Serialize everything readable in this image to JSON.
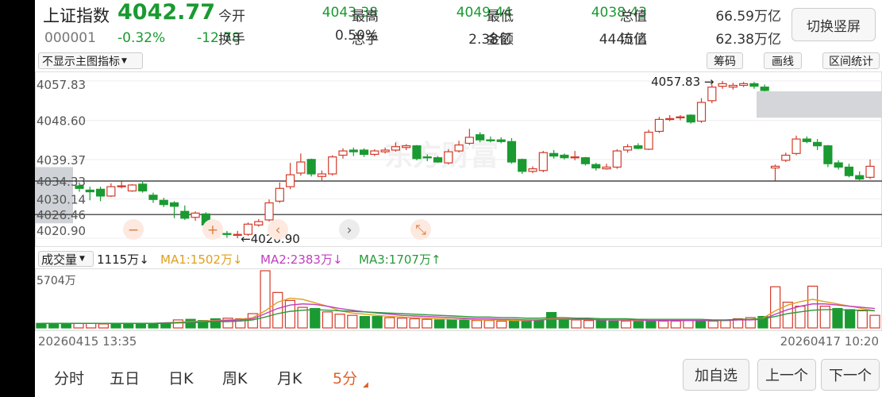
{
  "header": {
    "name": "上证指数",
    "code": "000001",
    "price": "4042.77",
    "pct_change": "-0.32%",
    "change": "-12.78",
    "switch_label": "切换竖屏"
  },
  "quotes": [
    {
      "label": "今开",
      "value": "4043.38",
      "color": "#1a9a31"
    },
    {
      "label": "最高",
      "value": "4049.44",
      "color": "#1a9a31"
    },
    {
      "label": "最低",
      "value": "4038.43",
      "color": "#1a9a31"
    },
    {
      "label": "总值",
      "value": "66.59万亿",
      "color": "#333333"
    },
    {
      "label": "换手",
      "value": "0.50%",
      "color": "#333333"
    },
    {
      "label": "总手",
      "value": "2.38亿",
      "color": "#333333"
    },
    {
      "label": "金额",
      "value": "4445亿",
      "color": "#333333"
    },
    {
      "label": "流值",
      "value": "62.38万亿",
      "color": "#333333"
    }
  ],
  "toolbar": {
    "indicator_dropdown": "不显示主图指标",
    "chips": "筹码",
    "draw": "画线",
    "range_stats": "区间统计"
  },
  "price_axis": {
    "labels": [
      "4057.83",
      "4048.60",
      "4039.37",
      "4034.33",
      "4030.14",
      "4026.46",
      "4020.90"
    ],
    "high_marker": "4057.83",
    "low_marker": "4020.90",
    "hlines": [
      "4034.33",
      "4026.46"
    ]
  },
  "volume": {
    "dropdown": "成交量",
    "current": "1115万",
    "current_arrow": "↓",
    "ma1": "MA1:1502万",
    "ma1_arrow": "↓",
    "ma2": "MA2:2383万",
    "ma2_arrow": "↓",
    "ma3": "MA3:1707万",
    "ma3_arrow": "↑",
    "axis_max": "5704万",
    "colors": {
      "ma1": "#e0a020",
      "ma2": "#c040c0",
      "ma3": "#2a9a3a"
    }
  },
  "time_axis": {
    "start": "20260415 13:35",
    "end": "20260417 10:20"
  },
  "tabs": [
    "分时",
    "五日",
    "日K",
    "周K",
    "月K",
    "5分"
  ],
  "active_tab": 5,
  "buttons": {
    "add_fav": "加自选",
    "prev": "上一个",
    "next": "下一个"
  },
  "colors": {
    "up": "#d43b2a",
    "down": "#1a9a31",
    "price_down": "#1a9a31",
    "active_tab": "#e0612a"
  },
  "chart_data": {
    "type": "candlestick",
    "interval": "5分",
    "ylim": [
      4020.9,
      4057.83
    ],
    "candles": [
      {
        "o": 4033.2,
        "c": 4032.6,
        "h": 4034.0,
        "l": 4031.8
      },
      {
        "o": 4032.2,
        "c": 4031.8,
        "h": 4033.0,
        "l": 4029.8
      },
      {
        "o": 4032.4,
        "c": 4030.8,
        "h": 4033.0,
        "l": 4029.6
      },
      {
        "o": 4030.8,
        "c": 4033.0,
        "h": 4033.8,
        "l": 4030.6
      },
      {
        "o": 4033.0,
        "c": 4033.2,
        "h": 4034.2,
        "l": 4032.6
      },
      {
        "o": 4032.0,
        "c": 4033.4,
        "h": 4033.6,
        "l": 4031.8
      },
      {
        "o": 4033.6,
        "c": 4032.0,
        "h": 4034.4,
        "l": 4031.6
      },
      {
        "o": 4031.0,
        "c": 4030.0,
        "h": 4031.6,
        "l": 4029.2
      },
      {
        "o": 4029.8,
        "c": 4028.8,
        "h": 4030.4,
        "l": 4028.2
      },
      {
        "o": 4029.2,
        "c": 4028.4,
        "h": 4029.6,
        "l": 4025.6
      },
      {
        "o": 4027.2,
        "c": 4025.6,
        "h": 4028.6,
        "l": 4025.2
      },
      {
        "o": 4025.8,
        "c": 4026.8,
        "h": 4027.2,
        "l": 4025.0
      },
      {
        "o": 4026.6,
        "c": 4024.0,
        "h": 4027.0,
        "l": 4023.4
      },
      {
        "o": 4023.0,
        "c": 4022.2,
        "h": 4023.6,
        "l": 4021.6
      },
      {
        "o": 4022.0,
        "c": 4021.8,
        "h": 4022.6,
        "l": 4021.0
      },
      {
        "o": 4021.6,
        "c": 4021.8,
        "h": 4022.6,
        "l": 4020.9
      },
      {
        "o": 4021.8,
        "c": 4024.2,
        "h": 4024.6,
        "l": 4021.4
      },
      {
        "o": 4024.0,
        "c": 4024.8,
        "h": 4025.4,
        "l": 4023.6
      },
      {
        "o": 4025.2,
        "c": 4029.2,
        "h": 4030.0,
        "l": 4024.8
      },
      {
        "o": 4029.6,
        "c": 4032.6,
        "h": 4034.0,
        "l": 4029.2
      },
      {
        "o": 4033.0,
        "c": 4035.8,
        "h": 4038.6,
        "l": 4032.4
      },
      {
        "o": 4036.2,
        "c": 4038.8,
        "h": 4040.8,
        "l": 4035.6
      },
      {
        "o": 4039.4,
        "c": 4036.0,
        "h": 4039.6,
        "l": 4035.4
      },
      {
        "o": 4035.4,
        "c": 4036.0,
        "h": 4036.8,
        "l": 4034.2
      },
      {
        "o": 4036.0,
        "c": 4040.0,
        "h": 4040.4,
        "l": 4035.6
      },
      {
        "o": 4040.4,
        "c": 4041.4,
        "h": 4042.0,
        "l": 4039.6
      },
      {
        "o": 4041.6,
        "c": 4041.2,
        "h": 4042.2,
        "l": 4040.2
      },
      {
        "o": 4041.6,
        "c": 4040.6,
        "h": 4042.0,
        "l": 4040.0
      },
      {
        "o": 4040.6,
        "c": 4041.4,
        "h": 4041.8,
        "l": 4040.2
      },
      {
        "o": 4041.2,
        "c": 4041.6,
        "h": 4042.2,
        "l": 4040.8
      },
      {
        "o": 4041.6,
        "c": 4042.4,
        "h": 4043.4,
        "l": 4041.2
      },
      {
        "o": 4042.2,
        "c": 4042.6,
        "h": 4043.0,
        "l": 4041.6
      },
      {
        "o": 4042.6,
        "c": 4039.6,
        "h": 4042.8,
        "l": 4039.2
      },
      {
        "o": 4040.0,
        "c": 4039.8,
        "h": 4040.6,
        "l": 4039.0
      },
      {
        "o": 4039.8,
        "c": 4038.8,
        "h": 4040.2,
        "l": 4038.6
      },
      {
        "o": 4038.6,
        "c": 4041.2,
        "h": 4041.8,
        "l": 4038.2
      },
      {
        "o": 4041.4,
        "c": 4042.8,
        "h": 4043.8,
        "l": 4041.0
      },
      {
        "o": 4043.2,
        "c": 4044.6,
        "h": 4046.6,
        "l": 4042.8
      },
      {
        "o": 4045.2,
        "c": 4044.0,
        "h": 4045.8,
        "l": 4043.4
      },
      {
        "o": 4044.0,
        "c": 4043.8,
        "h": 4044.8,
        "l": 4043.4
      },
      {
        "o": 4044.0,
        "c": 4043.6,
        "h": 4044.6,
        "l": 4043.2
      },
      {
        "o": 4043.6,
        "c": 4038.8,
        "h": 4044.4,
        "l": 4038.4
      },
      {
        "o": 4039.4,
        "c": 4036.6,
        "h": 4039.6,
        "l": 4036.0
      },
      {
        "o": 4036.6,
        "c": 4037.2,
        "h": 4037.8,
        "l": 4036.2
      },
      {
        "o": 4036.8,
        "c": 4041.0,
        "h": 4041.4,
        "l": 4036.4
      },
      {
        "o": 4040.8,
        "c": 4040.2,
        "h": 4041.6,
        "l": 4039.6
      },
      {
        "o": 4040.4,
        "c": 4039.8,
        "h": 4040.8,
        "l": 4039.4
      },
      {
        "o": 4039.8,
        "c": 4040.0,
        "h": 4041.4,
        "l": 4039.2
      },
      {
        "o": 4039.8,
        "c": 4038.4,
        "h": 4040.0,
        "l": 4038.0
      },
      {
        "o": 4038.2,
        "c": 4037.4,
        "h": 4038.6,
        "l": 4036.8
      },
      {
        "o": 4037.2,
        "c": 4037.6,
        "h": 4038.4,
        "l": 4037.0
      },
      {
        "o": 4037.6,
        "c": 4041.4,
        "h": 4041.8,
        "l": 4037.2
      },
      {
        "o": 4041.6,
        "c": 4042.4,
        "h": 4043.0,
        "l": 4041.0
      },
      {
        "o": 4042.6,
        "c": 4042.0,
        "h": 4043.2,
        "l": 4041.8
      },
      {
        "o": 4041.8,
        "c": 4045.8,
        "h": 4046.4,
        "l": 4041.6
      },
      {
        "o": 4046.0,
        "c": 4048.8,
        "h": 4049.4,
        "l": 4045.6
      },
      {
        "o": 4049.0,
        "c": 4049.0,
        "h": 4049.8,
        "l": 4048.4
      },
      {
        "o": 4049.4,
        "c": 4049.4,
        "h": 4049.8,
        "l": 4048.6
      },
      {
        "o": 4049.8,
        "c": 4048.2,
        "h": 4050.0,
        "l": 4047.8
      },
      {
        "o": 4048.4,
        "c": 4052.8,
        "h": 4053.8,
        "l": 4048.0
      },
      {
        "o": 4053.2,
        "c": 4056.4,
        "h": 4057.0,
        "l": 4052.6
      },
      {
        "o": 4056.6,
        "c": 4057.2,
        "h": 4057.83,
        "l": 4056.0
      },
      {
        "o": 4056.4,
        "c": 4056.8,
        "h": 4057.4,
        "l": 4055.8
      },
      {
        "o": 4056.8,
        "c": 4057.2,
        "h": 4057.6,
        "l": 4056.4
      },
      {
        "o": 4057.2,
        "c": 4056.6,
        "h": 4057.6,
        "l": 4056.0
      },
      {
        "o": 4056.4,
        "c": 4055.6,
        "h": 4057.0,
        "l": 4055.4
      },
      {
        "o": 4037.4,
        "c": 4037.8,
        "h": 4038.2,
        "l": 4034.4
      },
      {
        "o": 4039.2,
        "c": 4040.4,
        "h": 4041.0,
        "l": 4038.8
      },
      {
        "o": 4040.8,
        "c": 4044.2,
        "h": 4045.0,
        "l": 4040.4
      },
      {
        "o": 4044.2,
        "c": 4043.6,
        "h": 4044.8,
        "l": 4043.2
      },
      {
        "o": 4043.4,
        "c": 4042.6,
        "h": 4044.2,
        "l": 4041.6
      },
      {
        "o": 4042.6,
        "c": 4038.4,
        "h": 4042.8,
        "l": 4037.6
      },
      {
        "o": 4038.6,
        "c": 4037.6,
        "h": 4039.2,
        "l": 4037.0
      },
      {
        "o": 4037.6,
        "c": 4035.6,
        "h": 4038.4,
        "l": 4035.2
      },
      {
        "o": 4035.6,
        "c": 4034.8,
        "h": 4036.6,
        "l": 4034.2
      },
      {
        "o": 4035.2,
        "c": 4037.8,
        "h": 4039.4,
        "l": 4034.8
      }
    ],
    "volumes": [
      8,
      8,
      8,
      8,
      8,
      7,
      8,
      8,
      8,
      7,
      8,
      14,
      15,
      13,
      16,
      17,
      16,
      25,
      100,
      62,
      48,
      36,
      34,
      28,
      24,
      22,
      20,
      20,
      18,
      17,
      16,
      15,
      14,
      14,
      14,
      13,
      13,
      12,
      12,
      12,
      13,
      27,
      15,
      14,
      13,
      13,
      12,
      12,
      12,
      12,
      12,
      12,
      13,
      12,
      12,
      13,
      16,
      18,
      20,
      72,
      45,
      38,
      73,
      38,
      34,
      32,
      30,
      22
    ],
    "ma1": [
      8,
      8,
      8,
      8,
      8,
      8,
      8,
      8,
      8,
      8,
      9,
      10,
      11,
      12,
      13,
      14,
      15,
      18,
      30,
      45,
      52,
      50,
      44,
      38,
      30,
      26,
      24,
      22,
      20,
      19,
      18,
      17,
      16,
      15,
      15,
      14,
      14,
      14,
      13,
      13,
      14,
      16,
      16,
      15,
      15,
      14,
      14,
      13,
      13,
      13,
      13,
      13,
      13,
      13,
      13,
      13,
      14,
      15,
      17,
      30,
      40,
      46,
      50,
      46,
      42,
      38,
      34,
      30
    ],
    "ma2": [
      8,
      8,
      8,
      8,
      8,
      8,
      8,
      8,
      8,
      8,
      9,
      9,
      10,
      11,
      12,
      13,
      14,
      16,
      25,
      34,
      40,
      42,
      41,
      38,
      34,
      31,
      28,
      26,
      24,
      22,
      21,
      20,
      19,
      18,
      17,
      16,
      16,
      15,
      15,
      14,
      14,
      15,
      15,
      15,
      15,
      14,
      14,
      14,
      14,
      13,
      13,
      13,
      13,
      13,
      13,
      13,
      14,
      14,
      15,
      24,
      32,
      38,
      42,
      42,
      40,
      38,
      36,
      34
    ],
    "ma3": [
      8,
      8,
      8,
      8,
      8,
      8,
      8,
      8,
      8,
      8,
      8,
      9,
      9,
      10,
      11,
      11,
      12,
      14,
      19,
      25,
      29,
      31,
      32,
      31,
      30,
      29,
      28,
      27,
      26,
      25,
      24,
      23,
      22,
      21,
      20,
      19,
      19,
      18,
      18,
      17,
      17,
      18,
      18,
      17,
      17,
      16,
      16,
      16,
      15,
      15,
      15,
      15,
      15,
      15,
      14,
      14,
      15,
      15,
      16,
      20,
      25,
      28,
      31,
      32,
      32,
      31,
      31,
      30
    ],
    "volume_max": 5704
  }
}
